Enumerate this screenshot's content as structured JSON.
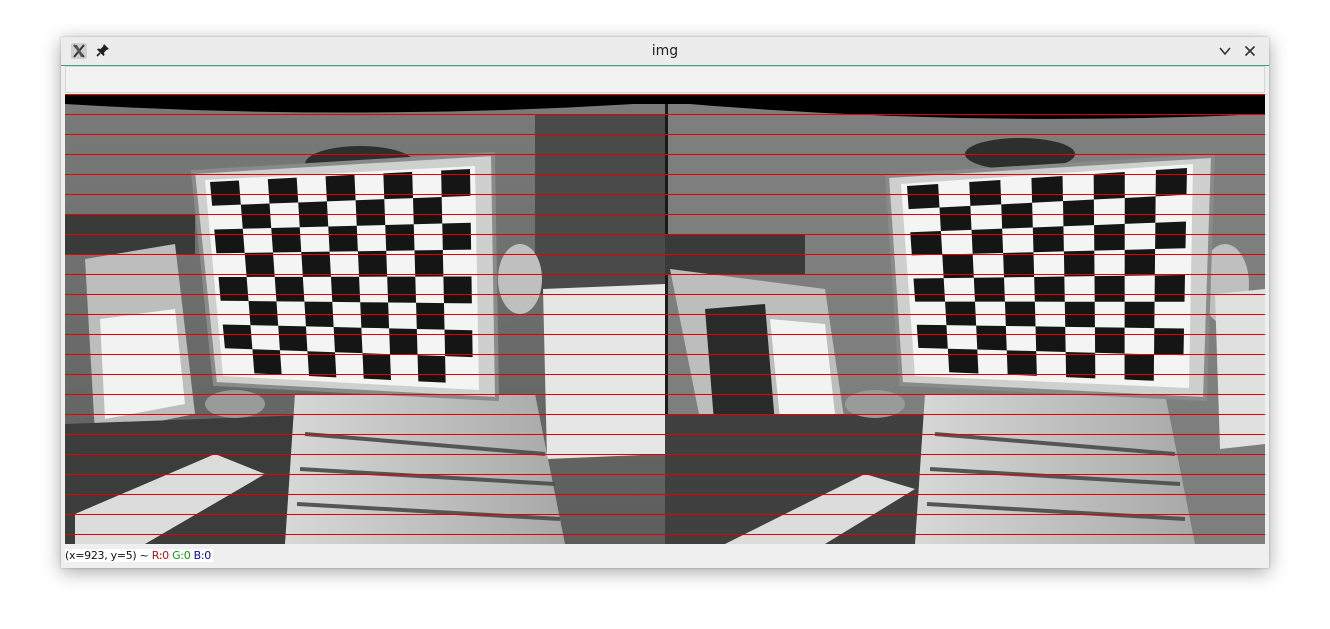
{
  "window": {
    "title": "img"
  },
  "icons": {
    "app": "x-app-icon",
    "pin": "pin-icon",
    "minimize": "chevron-down-icon",
    "close": "close-icon"
  },
  "canvas": {
    "description_colors": {
      "line": "#e00000"
    },
    "line_count": 23
  },
  "status": {
    "coords": "(x=923, y=5) ~",
    "r": "R:0",
    "g": "G:0",
    "b": "B:0"
  }
}
